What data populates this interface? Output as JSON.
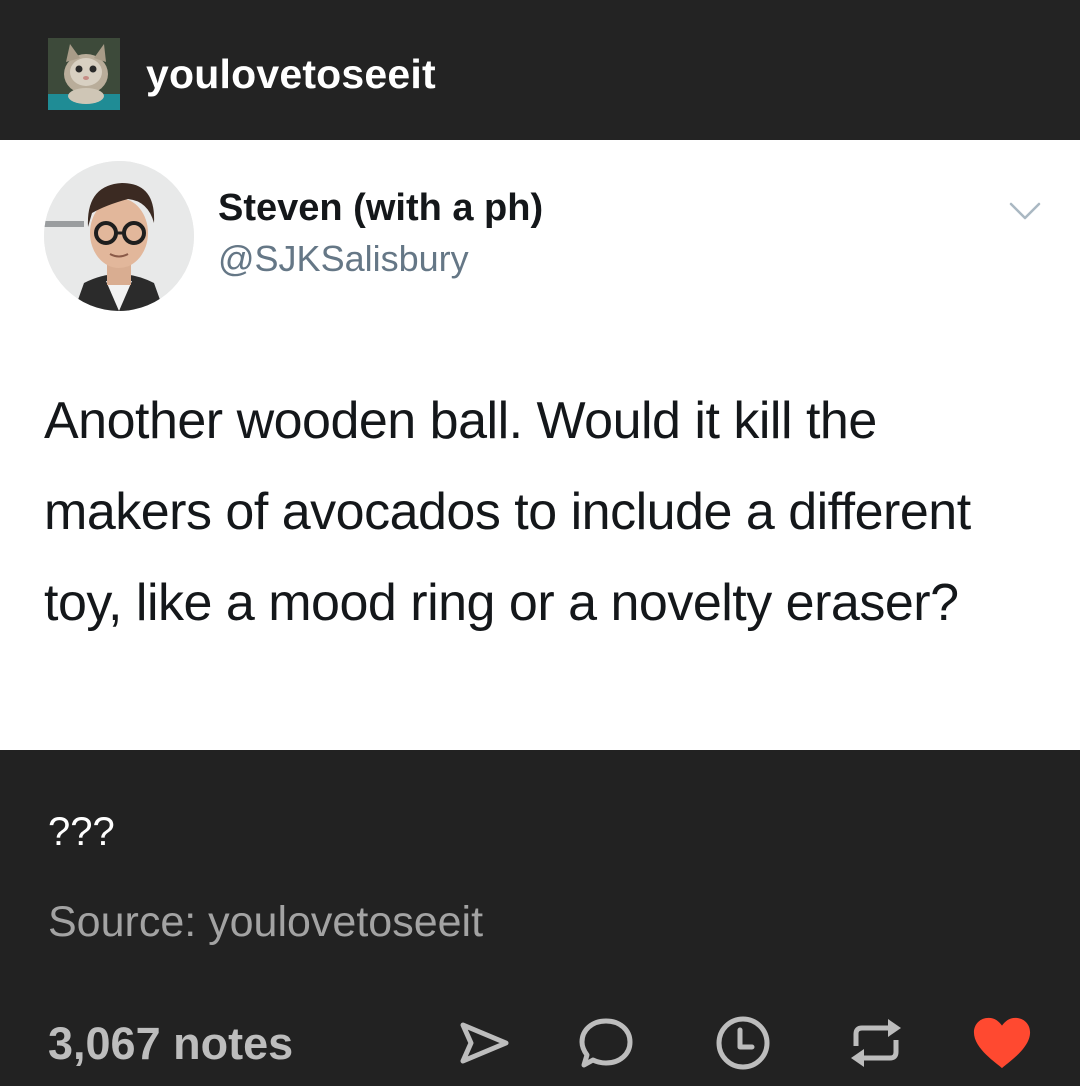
{
  "blog": {
    "name": "youlovetoseeit",
    "avatar_icon": "kitten-avatar"
  },
  "tweet": {
    "display_name": "Steven (with a ph)",
    "handle": "@SJKSalisbury",
    "text": "Another wooden ball. Would it kill the makers of avocados to include a different toy, like a mood ring or a novelty eraser?",
    "menu_icon": "chevron-down-icon"
  },
  "post": {
    "caption": "???",
    "source": "Source: youlovetoseeit"
  },
  "footer": {
    "notes": "3,067 notes",
    "actions": [
      "share-icon",
      "reply-icon",
      "queue-icon",
      "reblog-icon",
      "like-icon"
    ],
    "like_color": "#ff4930",
    "icon_color": "#bdbdbd"
  }
}
